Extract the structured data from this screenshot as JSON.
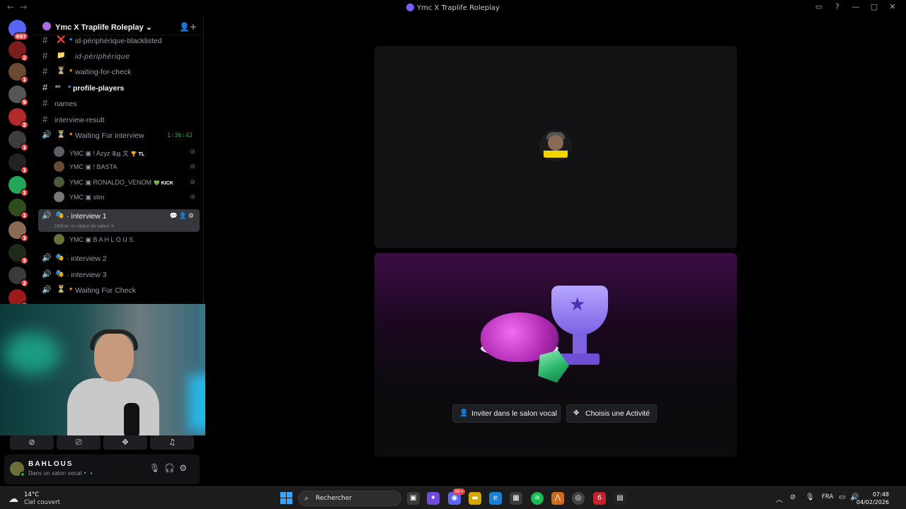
{
  "window": {
    "title": "Ymc X Traplife Roleplay",
    "nav_back": "←",
    "nav_forward": "→",
    "controls": [
      "▭",
      "?",
      "—",
      "▢",
      "✕"
    ]
  },
  "rail": {
    "badges": [
      "897",
      "2",
      "1",
      "9",
      "2",
      "1",
      "1",
      "1",
      "1",
      "1",
      "3",
      "2",
      "1"
    ]
  },
  "guild": {
    "name": "Ymc X Traplife Roleplay",
    "chevron": "⌄",
    "invite_icon": "👤+"
  },
  "channels": [
    {
      "name": "id-périphérique-blacklisted",
      "emoji": "❌",
      "dot": "🔹"
    },
    {
      "name": "id-périphérique",
      "emoji": "📁",
      "dot": ""
    },
    {
      "name": "waiting-for-check",
      "emoji": "⏳",
      "dot": "🔸"
    },
    {
      "name": "profile-players",
      "emoji": "✏",
      "dot": "🔹"
    },
    {
      "name": "names",
      "emoji": "",
      "dot": ""
    },
    {
      "name": "interview-result",
      "emoji": "",
      "dot": ""
    }
  ],
  "voice": {
    "waiting": {
      "name": "Waiting For interview",
      "timer": "1:36:42"
    },
    "waiting_users": [
      {
        "name": "YMC ▣ ! Azyz 𝕾𝖟𝖟 文",
        "tag": "🏆 TL"
      },
      {
        "name": "YMC ▣ ! BASTA",
        "tag": ""
      },
      {
        "name": "YMC ▣ RONALDO_VENOM",
        "tag": "💚 KICK"
      },
      {
        "name": "YMC ▣ slim",
        "tag": ""
      }
    ],
    "interview1": {
      "name": "interview 1",
      "status": "Définir un statut de salon ✎",
      "tools": "💬👤⚙"
    },
    "interview1_users": [
      {
        "name": "YMC ▣ B A H L O U S"
      }
    ],
    "interview2": {
      "name": "interview 2"
    },
    "interview3": {
      "name": "interview 3"
    },
    "waiting_check": {
      "name": "Waiting For Check"
    }
  },
  "controls": {
    "camera": "⊘",
    "screen": "⎚",
    "activity": "✥",
    "soundboard": "♫"
  },
  "user_panel": {
    "name": "BAHLOUS",
    "status": "Dans un salon vocal • 🔹",
    "mic": "🎙",
    "headset": "🎧",
    "settings": "⚙"
  },
  "stage": {
    "invite_button": "Inviter dans le salon vocal",
    "activity_button": "Choisis une Activité"
  },
  "taskbar": {
    "temperature": "14°C",
    "weather": "Ciel couvert",
    "search_placeholder": "Rechercher",
    "language": "FRA",
    "time": "07:48",
    "date": "04/02/2026",
    "discord_badge": "99+"
  }
}
